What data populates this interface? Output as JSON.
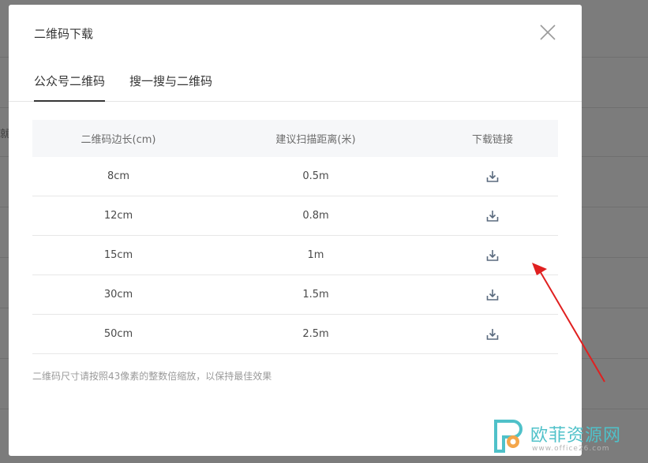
{
  "background": {
    "fragment": "就"
  },
  "dialog": {
    "title": "二维码下载",
    "tabs": [
      {
        "label": "公众号二维码",
        "active": true
      },
      {
        "label": "搜一搜与二维码",
        "active": false
      }
    ],
    "table": {
      "headers": [
        "二维码边长(cm)",
        "建议扫描距离(米)",
        "下载链接"
      ],
      "rows": [
        {
          "size": "8cm",
          "distance": "0.5m"
        },
        {
          "size": "12cm",
          "distance": "0.8m"
        },
        {
          "size": "15cm",
          "distance": "1m"
        },
        {
          "size": "30cm",
          "distance": "1.5m"
        },
        {
          "size": "50cm",
          "distance": "2.5m"
        }
      ]
    },
    "note": "二维码尺寸请按照43像素的整数倍缩放，以保持最佳效果"
  },
  "icons": {
    "close": "close-icon",
    "download": "download-icon"
  },
  "annotation": {
    "arrow_color": "#e02020"
  },
  "watermark": {
    "brand": "欧菲资源网",
    "site": "www.office26.com",
    "color": "#4fc1c9"
  }
}
